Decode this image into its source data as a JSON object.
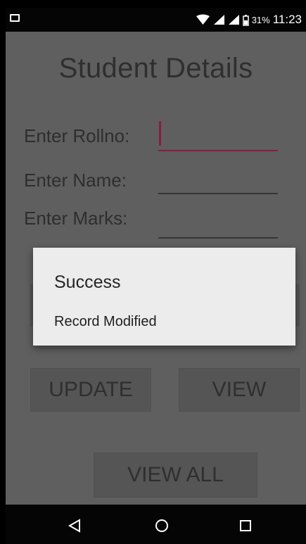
{
  "status_bar": {
    "battery_percent": "31%",
    "time": "11:23"
  },
  "app": {
    "title": "Student Details",
    "fields": {
      "rollno_label": "Enter Rollno:",
      "name_label": "Enter Name:",
      "marks_label": "Enter Marks:"
    },
    "buttons": {
      "update": "UPDATE",
      "view": "VIEW",
      "view_all": "VIEW ALL"
    }
  },
  "dialog": {
    "title": "Success",
    "message": "Record Modified"
  },
  "colors": {
    "accent": "#8b1b45",
    "dialog_background": "#ececec"
  },
  "icons": {
    "wifi": "wifi-icon",
    "signal": "signal-icon",
    "battery": "battery-icon",
    "back": "back-icon",
    "home": "home-icon",
    "recent": "recent-apps-icon"
  }
}
